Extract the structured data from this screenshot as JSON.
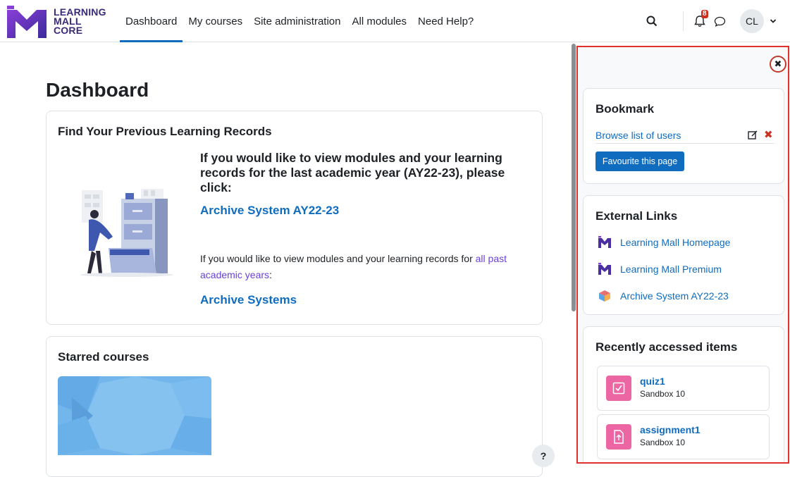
{
  "brand": {
    "line1": "LEARNING",
    "line2": "MALL",
    "line3": "CORE"
  },
  "nav": {
    "items": [
      {
        "label": "Dashboard",
        "active": true
      },
      {
        "label": "My courses"
      },
      {
        "label": "Site administration"
      },
      {
        "label": "All modules"
      },
      {
        "label": "Need Help?"
      }
    ],
    "notification_count": "8",
    "user_initials": "CL"
  },
  "page": {
    "title": "Dashboard"
  },
  "previous_records": {
    "title": "Find Your Previous Learning Records",
    "heading": "If you would like to view modules and your learning records for the last academic year (AY22-23), please click:",
    "archive_link": "Archive System AY22-23",
    "text_prefix": "If you would like to view modules and your learning records for ",
    "text_link": "all past academic years",
    "text_suffix": ":",
    "archives_link": "Archive Systems"
  },
  "starred": {
    "title": "Starred courses"
  },
  "help": {
    "label": "?"
  },
  "drawer": {
    "bookmark": {
      "title": "Bookmark",
      "item": "Browse list of users",
      "button": "Favourite this page"
    },
    "external_links": {
      "title": "External Links",
      "items": [
        {
          "label": "Learning Mall Homepage",
          "icon": "learning-mall-logo-icon"
        },
        {
          "label": "Learning Mall Premium",
          "icon": "learning-mall-logo-icon"
        },
        {
          "label": "Archive System AY22-23",
          "icon": "archive-cube-icon"
        }
      ]
    },
    "recent": {
      "title": "Recently accessed items",
      "items": [
        {
          "name": "quiz1",
          "course": "Sandbox 10",
          "icon": "quiz-icon"
        },
        {
          "name": "assignment1",
          "course": "Sandbox 10",
          "icon": "assignment-icon"
        }
      ]
    }
  },
  "colors": {
    "primary": "#0f6cbf",
    "brand": "#3a2a7a",
    "activity_pink": "#eb66a2",
    "drawer_border": "#e2312c"
  }
}
